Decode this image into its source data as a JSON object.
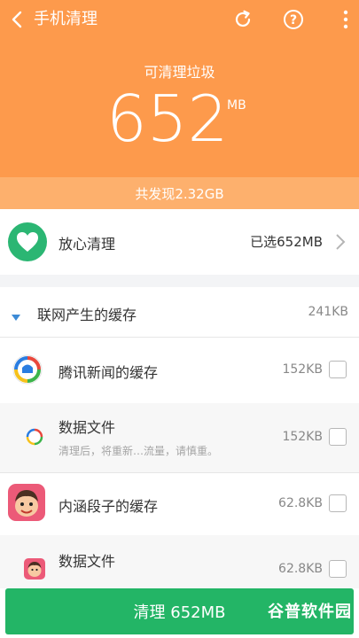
{
  "header": {
    "title": "手机清理",
    "subtitle": "可清理垃圾",
    "amount": "652",
    "unit": "MB",
    "found_text": "共发现2.32GB"
  },
  "safe_clean": {
    "label": "放心清理",
    "selected_text": "已选652MB"
  },
  "group": {
    "label": "联网产生的缓存",
    "size": "241KB"
  },
  "items": [
    {
      "label": "腾讯新闻的缓存",
      "size": "152KB"
    },
    {
      "label": "数据文件",
      "desc": "清理后，将重新…流量，请慎重。",
      "size": "152KB"
    },
    {
      "label": "内涵段子的缓存",
      "size": "62.8KB"
    },
    {
      "label": "数据文件",
      "size": "62.8KB"
    }
  ],
  "footer": {
    "button_label": "清理 652MB",
    "watermark": "谷普软件园"
  },
  "colors": {
    "header_orange": "#fd9a4c",
    "button_green": "#23b566",
    "heart_green": "#2bb673"
  }
}
